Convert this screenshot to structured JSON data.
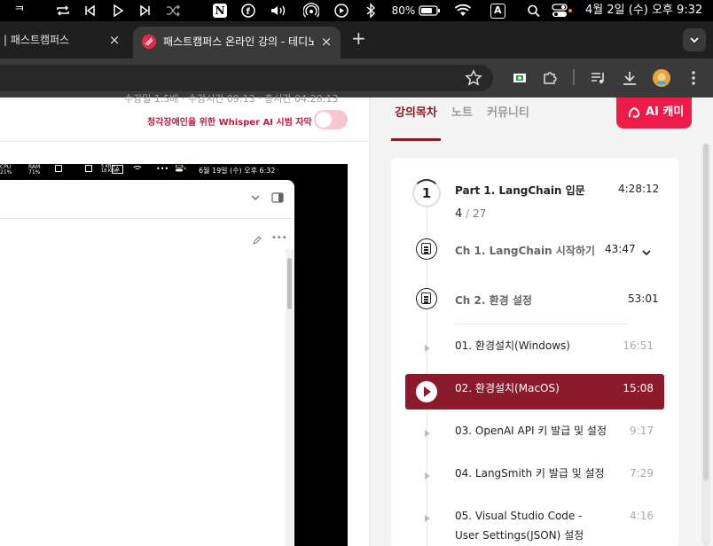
{
  "menubar": {
    "icons": [
      "keyboard-layout-icon",
      "repeat-icon",
      "previous-track-icon",
      "play-icon",
      "next-track-icon",
      "shuffle-icon",
      "notion-icon",
      "info-icon",
      "volume-icon",
      "airdrop-icon",
      "media-play-icon",
      "bluetooth-icon",
      "battery-icon",
      "wifi-icon",
      "control-center-icon"
    ],
    "notion_letter": "N",
    "battery": "80%",
    "input_source": "A",
    "clock": "4월 2일 (수) 오후 9:32"
  },
  "browser": {
    "tabs": [
      {
        "title": "| 패스트캠퍼스",
        "active": false
      },
      {
        "title": "패스트캠퍼스 온라인 강의 - 테디노트",
        "active": true
      }
    ],
    "new_tab": "+",
    "close": "×"
  },
  "video_header": {
    "top_text": "수강일 1.5배 · 수강시간 09:13 · 총시간 04:28:13",
    "whisper_label": "청각장애인을 위한 Whisper AI 시범 자막",
    "whisper_enabled": false
  },
  "video": {
    "menubar": {
      "cpu": "CPU\n21%",
      "ram": "RAM\n71%",
      "input": "A",
      "net": "5 KB/s\n18 KB/s",
      "clock": "6월 19일 (수) 오후 6:32"
    }
  },
  "panel": {
    "tabs": [
      {
        "label": "강의목차",
        "active": true
      },
      {
        "label": "노트",
        "active": false
      },
      {
        "label": "커뮤니티",
        "active": false
      }
    ],
    "ai_button": "AI 캐미",
    "part": {
      "number": "1",
      "title": "Part 1. LangChain 입문",
      "time": "4:28:12",
      "progress_done": "4",
      "progress_sep": "/",
      "progress_total": "27"
    },
    "chapters": [
      {
        "title": "Ch 1. LangChain 시작하기",
        "time": "43:47",
        "expanded": false
      },
      {
        "title": "Ch 2. 환경 설정",
        "time": "53:01",
        "expanded": true
      }
    ],
    "lectures": [
      {
        "title": "01. 환경설치(Windows)",
        "time": "16:51",
        "active": false
      },
      {
        "title": "02. 환경설치(MacOS)",
        "time": "15:08",
        "active": true
      },
      {
        "title": "03. OpenAI API 키 발급 및 설정",
        "time": "9:17",
        "active": false
      },
      {
        "title": "04. LangSmith 키 발급 및 설정",
        "time": "7:29",
        "active": false
      },
      {
        "title": "05. Visual Studio Code -",
        "title2": "User Settings(JSON) 설정",
        "time": "4:16",
        "active": false
      }
    ]
  },
  "colors": {
    "accent": "#8b1a2b",
    "ai_button": "#ee1b49",
    "whisper_text": "#c01a3c"
  }
}
